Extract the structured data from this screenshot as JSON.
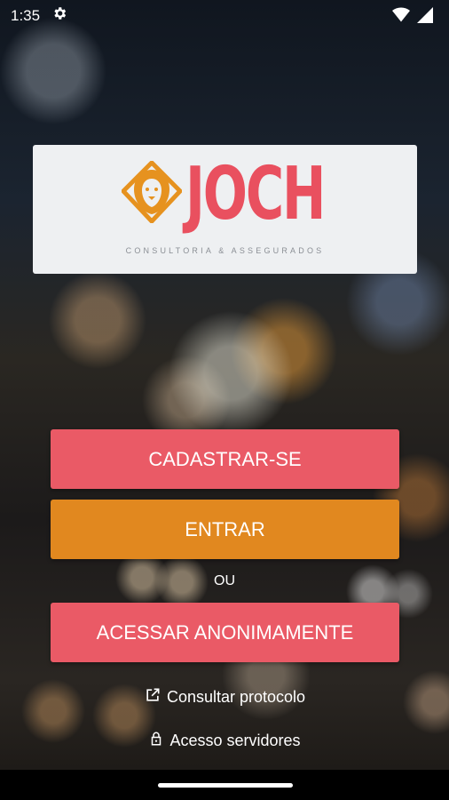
{
  "status_bar": {
    "time": "1:35",
    "icons": [
      "gear-icon",
      "wifi-icon",
      "signal-icon"
    ]
  },
  "logo": {
    "brand": "JOCH",
    "tagline": "CONSULTORIA & ASSEGURADOS",
    "icon": "lion-icon",
    "colors": {
      "brand": "#e9505f",
      "lion": "#e6921f"
    }
  },
  "actions": {
    "register_label": "CADASTRAR-SE",
    "login_label": "ENTRAR",
    "or_label": "OU",
    "anonymous_label": "ACESSAR ANONIMAMENTE"
  },
  "links": {
    "protocol_label": "Consultar protocolo",
    "protocol_icon": "external-link-icon",
    "servers_label": "Acesso servidores",
    "servers_icon": "lock-icon"
  },
  "colors": {
    "red_button": "#ea5a66",
    "orange_button": "#e1881f"
  }
}
